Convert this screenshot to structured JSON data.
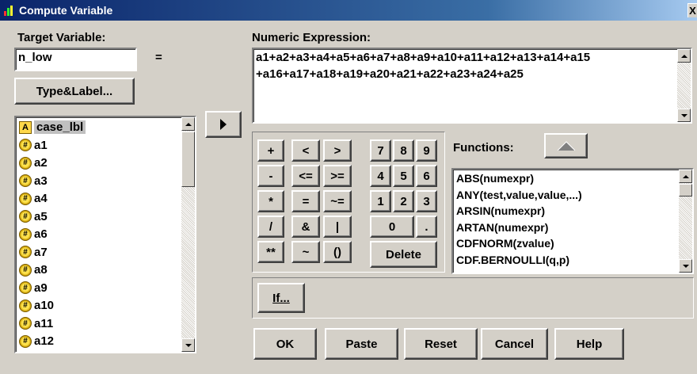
{
  "window": {
    "title": "Compute Variable",
    "close_glyph": "X"
  },
  "target": {
    "label": "Target Variable:",
    "value": "n_low",
    "equals": "="
  },
  "type_label_button": "Type&Label...",
  "expression": {
    "label": "Numeric Expression:",
    "line1": "a1+a2+a3+a4+a5+a6+a7+a8+a9+a10+a11+a12+a13+a14+a15",
    "line2": "+a16+a17+a18+a19+a20+a21+a22+a23+a24+a25"
  },
  "variables": [
    {
      "name": "case_lbl",
      "type": "string"
    },
    {
      "name": "a1",
      "type": "numeric"
    },
    {
      "name": "a2",
      "type": "numeric"
    },
    {
      "name": "a3",
      "type": "numeric"
    },
    {
      "name": "a4",
      "type": "numeric"
    },
    {
      "name": "a5",
      "type": "numeric"
    },
    {
      "name": "a6",
      "type": "numeric"
    },
    {
      "name": "a7",
      "type": "numeric"
    },
    {
      "name": "a8",
      "type": "numeric"
    },
    {
      "name": "a9",
      "type": "numeric"
    },
    {
      "name": "a10",
      "type": "numeric"
    },
    {
      "name": "a11",
      "type": "numeric"
    },
    {
      "name": "a12",
      "type": "numeric"
    }
  ],
  "keypad": {
    "ops": [
      [
        "+",
        "<",
        ">"
      ],
      [
        "-",
        "<=",
        ">="
      ],
      [
        "*",
        "=",
        "~="
      ],
      [
        "/",
        "&",
        "|"
      ],
      [
        "**",
        "~",
        "()"
      ]
    ],
    "digits": [
      [
        "7",
        "8",
        "9"
      ],
      [
        "4",
        "5",
        "6"
      ],
      [
        "1",
        "2",
        "3"
      ]
    ],
    "zero": "0",
    "dot": ".",
    "delete": "Delete"
  },
  "functions": {
    "label": "Functions:",
    "items": [
      "ABS(numexpr)",
      "ANY(test,value,value,...)",
      "ARSIN(numexpr)",
      "ARTAN(numexpr)",
      "CDFNORM(zvalue)",
      "CDF.BERNOULLI(q,p)"
    ]
  },
  "buttons": {
    "if": "If...",
    "ok": "OK",
    "paste": "Paste",
    "reset": "Reset",
    "cancel": "Cancel",
    "help": "Help"
  },
  "colors": {
    "titlebar": "#0a246a",
    "face": "#d4d0c8",
    "selection": "#c0c0c0"
  },
  "icons": {
    "move_arrow": "right-arrow-icon",
    "functions_arrow": "up-arrow-icon"
  }
}
